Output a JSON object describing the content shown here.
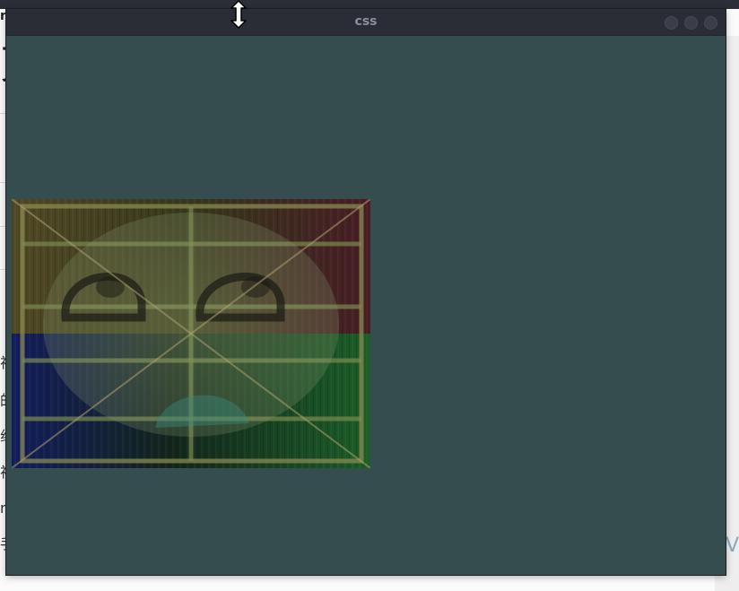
{
  "window": {
    "title": "css",
    "controls": [
      "close",
      "minimize",
      "maximize"
    ]
  },
  "background_page": {
    "corner_text": "n",
    "big_char": "页",
    "side_chars": [
      "视",
      "的",
      "组",
      "视",
      "n",
      "手"
    ]
  },
  "content": {
    "image_name": "filtered-image",
    "icon": "x-placeholder-icon"
  },
  "cursor": {
    "icon": "resize-vertical-cursor-icon"
  }
}
